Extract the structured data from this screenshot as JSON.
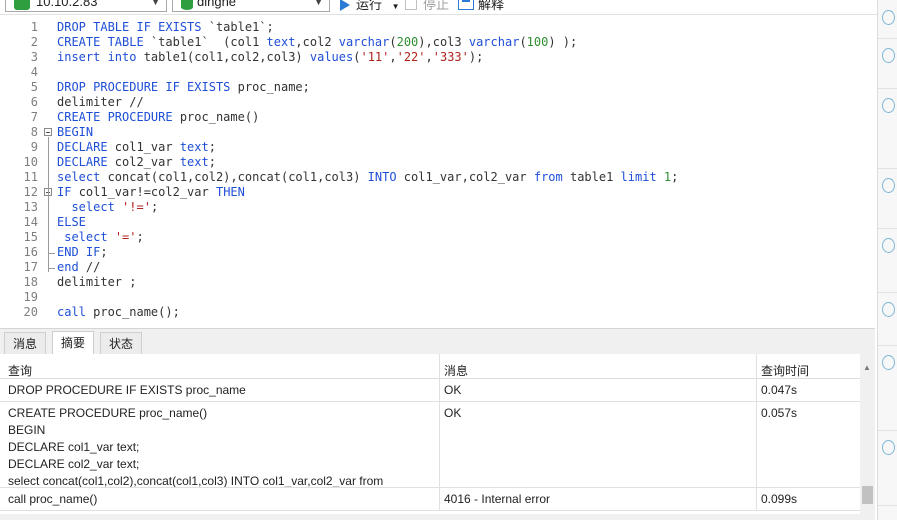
{
  "toolbar": {
    "connection": "10.10.2.83",
    "database": "dingne",
    "run_label": "运行",
    "stop_label": "停止",
    "explain_label": "解释"
  },
  "editor": {
    "lines": [
      {
        "n": "1",
        "tokens": [
          [
            "kw",
            "DROP TABLE IF EXISTS "
          ],
          [
            "plain",
            "`table1`;"
          ]
        ]
      },
      {
        "n": "2",
        "tokens": [
          [
            "kw",
            "CREATE TABLE "
          ],
          [
            "plain",
            "`table1`  (col1 "
          ],
          [
            "kw",
            "text"
          ],
          [
            "plain",
            ",col2 "
          ],
          [
            "kw",
            "varchar"
          ],
          [
            "plain",
            "("
          ],
          [
            "num",
            "200"
          ],
          [
            "plain",
            "),col3 "
          ],
          [
            "kw",
            "varchar"
          ],
          [
            "plain",
            "("
          ],
          [
            "num",
            "100"
          ],
          [
            "plain",
            ") );"
          ]
        ]
      },
      {
        "n": "3",
        "tokens": [
          [
            "kw",
            "insert into "
          ],
          [
            "plain",
            "table1(col1,col2,col3) "
          ],
          [
            "kw",
            "values"
          ],
          [
            "plain",
            "("
          ],
          [
            "str",
            "'11'"
          ],
          [
            "plain",
            ","
          ],
          [
            "str",
            "'22'"
          ],
          [
            "plain",
            ","
          ],
          [
            "str",
            "'333'"
          ],
          [
            "plain",
            ");"
          ]
        ]
      },
      {
        "n": "4",
        "tokens": []
      },
      {
        "n": "5",
        "tokens": [
          [
            "kw",
            "DROP PROCEDURE IF EXISTS "
          ],
          [
            "plain",
            "proc_name;"
          ]
        ]
      },
      {
        "n": "6",
        "tokens": [
          [
            "plain",
            "delimiter //"
          ]
        ]
      },
      {
        "n": "7",
        "tokens": [
          [
            "kw",
            "CREATE PROCEDURE "
          ],
          [
            "plain",
            "proc_name()"
          ]
        ]
      },
      {
        "n": "8",
        "tokens": [
          [
            "kw",
            "BEGIN"
          ]
        ]
      },
      {
        "n": "9",
        "tokens": [
          [
            "kw",
            "DECLARE "
          ],
          [
            "plain",
            "col1_var "
          ],
          [
            "kw",
            "text"
          ],
          [
            "plain",
            ";"
          ]
        ]
      },
      {
        "n": "10",
        "tokens": [
          [
            "kw",
            "DECLARE "
          ],
          [
            "plain",
            "col2_var "
          ],
          [
            "kw",
            "text"
          ],
          [
            "plain",
            ";"
          ]
        ]
      },
      {
        "n": "11",
        "tokens": [
          [
            "kw",
            "select "
          ],
          [
            "plain",
            "concat(col1,col2),concat(col1,col3) "
          ],
          [
            "kw",
            "INTO "
          ],
          [
            "plain",
            "col1_var,col2_var "
          ],
          [
            "kw",
            "from "
          ],
          [
            "plain",
            "table1 "
          ],
          [
            "kw",
            "limit "
          ],
          [
            "num",
            "1"
          ],
          [
            "plain",
            ";"
          ]
        ]
      },
      {
        "n": "12",
        "tokens": [
          [
            "kw",
            "IF "
          ],
          [
            "plain",
            "col1_var!=col2_var "
          ],
          [
            "kw",
            "THEN"
          ]
        ]
      },
      {
        "n": "13",
        "tokens": [
          [
            "plain",
            "  "
          ],
          [
            "kw",
            "select "
          ],
          [
            "str",
            "'!='"
          ],
          [
            "plain",
            ";"
          ]
        ]
      },
      {
        "n": "14",
        "tokens": [
          [
            "kw",
            "ELSE"
          ]
        ]
      },
      {
        "n": "15",
        "tokens": [
          [
            "plain",
            " "
          ],
          [
            "kw",
            "select "
          ],
          [
            "str",
            "'='"
          ],
          [
            "plain",
            ";"
          ]
        ]
      },
      {
        "n": "16",
        "tokens": [
          [
            "kw",
            "END IF"
          ],
          [
            "plain",
            ";"
          ]
        ]
      },
      {
        "n": "17",
        "tokens": [
          [
            "kw",
            "end "
          ],
          [
            "plain",
            "//"
          ]
        ]
      },
      {
        "n": "18",
        "tokens": [
          [
            "plain",
            "delimiter ;"
          ]
        ]
      },
      {
        "n": "19",
        "tokens": []
      },
      {
        "n": "20",
        "tokens": [
          [
            "kw",
            "call "
          ],
          [
            "plain",
            "proc_name();"
          ]
        ]
      }
    ]
  },
  "tabs": [
    "消息",
    "摘要",
    "状态"
  ],
  "active_tab": 1,
  "results": {
    "headers": [
      "查询",
      "消息",
      "查询时间"
    ],
    "rows": [
      {
        "query": "DROP PROCEDURE IF EXISTS proc_name",
        "message": "OK",
        "time": "0.047s"
      },
      {
        "query": "CREATE PROCEDURE proc_name()\nBEGIN\nDECLARE col1_var text;\nDECLARE col2_var text;\nselect concat(col1,col2),concat(col1,col3) INTO col1_var,col2_var from",
        "message": "OK",
        "time": "0.057s"
      },
      {
        "query": "call proc_name()",
        "message": "4016 - Internal error",
        "time": "0.099s"
      }
    ]
  },
  "colors": {
    "keyword": "#1f4fd6",
    "string": "#b0231d",
    "number": "#2f8f2f",
    "run_icon": "#2a7bd6",
    "connection_icon": "#2e9e3e",
    "database_icon": "#2e9e3e"
  }
}
